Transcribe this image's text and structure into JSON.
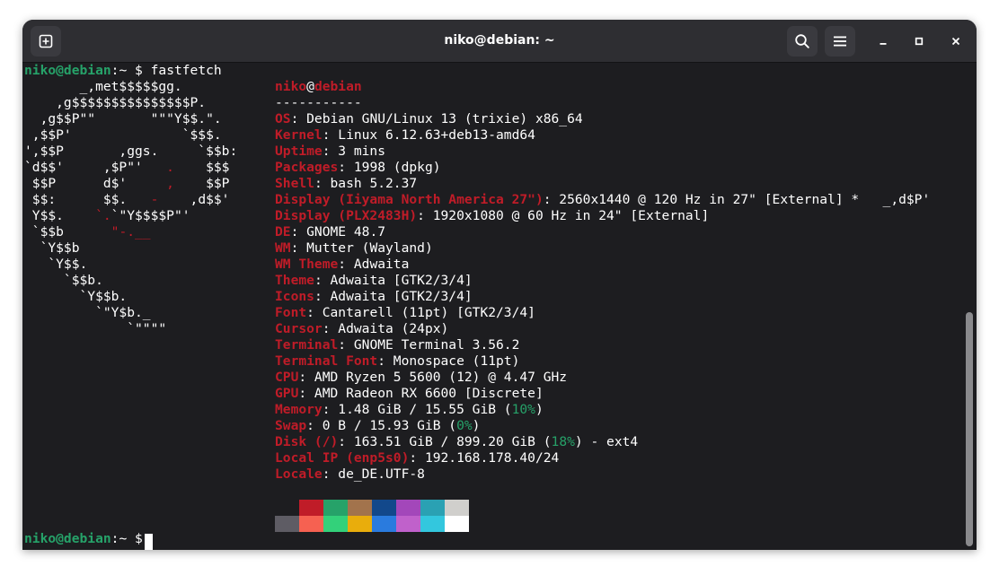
{
  "window": {
    "title": "niko@debian: ~"
  },
  "headerbar": {
    "new_tab_icon": "new-tab-icon",
    "search_icon": "search-icon",
    "menu_icon": "hamburger-menu-icon",
    "minimize_icon": "minimize-icon",
    "maximize_icon": "maximize-icon",
    "close_icon": "close-icon"
  },
  "prompt": {
    "user_host": "niko@debian",
    "path": ":~",
    "symbol": "$",
    "command": "fastfetch"
  },
  "logo_lines": [
    [
      "       _,met$$$$$gg.",
      ""
    ],
    [
      "    ,g$$$$$$$$$$$$$$$P.",
      ""
    ],
    [
      "  ,g$$P\"\"       \"\"\"Y$$.\".",
      ""
    ],
    [
      " ,$$P'              `$$$.",
      ""
    ],
    [
      "',$$P       ,ggs.     `$$b:",
      ""
    ],
    [
      "`d$$'     ,$P\"'   ",
      ".",
      "    $$$"
    ],
    [
      " $$P      d$'     ",
      ",",
      "    $$P"
    ],
    [
      " $$:      $$.   ",
      "-",
      "    ,d$$'"
    ],
    [
      " Y$$.    ",
      "`.",
      "`\"Y$$$$P\"'"
    ],
    [
      " `$$b      ",
      "\"-.__",
      ""
    ],
    [
      "  `Y$$b",
      ""
    ],
    [
      "   `Y$$.",
      ""
    ],
    [
      "     `$$b.",
      ""
    ],
    [
      "       `Y$$b.",
      ""
    ],
    [
      "         `\"Y$b._",
      ""
    ],
    [
      "             `\"\"\"\"",
      ""
    ]
  ],
  "fetch": {
    "user": "niko",
    "at": "@",
    "host": "debian",
    "separator": "-----------",
    "rows": [
      {
        "key": "OS",
        "value": ": Debian GNU/Linux 13 (trixie) x86_64"
      },
      {
        "key": "Kernel",
        "value": ": Linux 6.12.63+deb13-amd64"
      },
      {
        "key": "Uptime",
        "value": ": 3 mins"
      },
      {
        "key": "Packages",
        "value": ": 1998 (dpkg)"
      },
      {
        "key": "Shell",
        "value": ": bash 5.2.37"
      },
      {
        "key": "Display (Iiyama North America 27\")",
        "value": ": 2560x1440 @ 120 Hz in 27\" [External] *   _,d$P'"
      },
      {
        "key": "Display (PLX2483H)",
        "value": ": 1920x1080 @ 60 Hz in 24\" [External]"
      },
      {
        "key": "DE",
        "value": ": GNOME 48.7"
      },
      {
        "key": "WM",
        "value": ": Mutter (Wayland)"
      },
      {
        "key": "WM Theme",
        "value": ": Adwaita"
      },
      {
        "key": "Theme",
        "value": ": Adwaita [GTK2/3/4]"
      },
      {
        "key": "Icons",
        "value": ": Adwaita [GTK2/3/4]"
      },
      {
        "key": "Font",
        "value": ": Cantarell (11pt) [GTK2/3/4]"
      },
      {
        "key": "Cursor",
        "value": ": Adwaita (24px)"
      },
      {
        "key": "Terminal",
        "value": ": GNOME Terminal 3.56.2"
      },
      {
        "key": "Terminal Font",
        "value": ": Monospace (11pt)"
      },
      {
        "key": "CPU",
        "value": ": AMD Ryzen 5 5600 (12) @ 4.47 GHz"
      },
      {
        "key": "GPU",
        "value": ": AMD Radeon RX 6600 [Discrete]"
      },
      {
        "key": "Memory",
        "value": ": 1.48 GiB / 15.55 GiB (",
        "pct": "10%",
        "tail": ")"
      },
      {
        "key": "Swap",
        "value": ": 0 B / 15.93 GiB (",
        "pct": "0%",
        "tail": ")"
      },
      {
        "key": "Disk (/)",
        "value": ": 163.51 GiB / 899.20 GiB (",
        "pct": "18%",
        "tail": ") - ext4"
      },
      {
        "key": "Local IP (enp5s0)",
        "value": ": 192.168.178.40/24"
      },
      {
        "key": "Locale",
        "value": ": de_DE.UTF-8"
      }
    ]
  },
  "palette": {
    "row1": [
      "#1d1d20",
      "#c01c28",
      "#26a269",
      "#a2734c",
      "#12488b",
      "#a347ba",
      "#2aa1b3",
      "#d0cfcc"
    ],
    "row2": [
      "#5e5c64",
      "#f66151",
      "#33d17a",
      "#e9ad0c",
      "#2a7bde",
      "#c061cb",
      "#33c7de",
      "#ffffff"
    ]
  },
  "scrollbar": {
    "position": 0.62
  }
}
